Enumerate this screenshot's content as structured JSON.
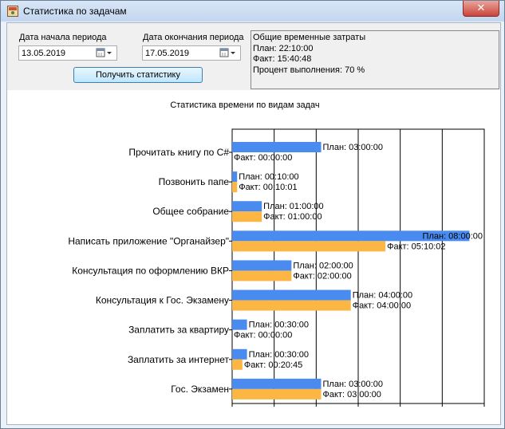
{
  "window": {
    "title": "Статистика по задачам",
    "close_label": "✕"
  },
  "filters": {
    "start_label": "Дата начала периода",
    "start_value": "13.05.2019",
    "end_label": "Дата окончания периода",
    "end_value": "17.05.2019",
    "button_label": "Получить статистику"
  },
  "summary": {
    "heading": "Общие временные затраты",
    "plan": "План: 22:10:00",
    "fact": "Факт: 15:40:48",
    "percent": "Процент выполнения: 70 %"
  },
  "colors": {
    "plan": "#4a8bef",
    "fact": "#fbb644"
  },
  "chart_data": {
    "type": "bar",
    "title": "Статистика времени по видам задач",
    "orientation": "horizontal",
    "x_unit": "hours",
    "xlim": [
      0,
      8.5
    ],
    "categories": [
      "Прочитать книгу по C#",
      "Позвонить папе",
      "Общее собрание",
      "Написать  приложение \"Органайзер\"",
      "Консультация по оформлению ВКР",
      "Консультация к Гос. Экзамену",
      "Заплатить за квартиру",
      "Заплатить за интернет",
      "Гос. Экзамен"
    ],
    "series": [
      {
        "values": [
          3.0,
          0.1667,
          1.0,
          8.0,
          2.0,
          4.0,
          0.5,
          0.5,
          3.0
        ],
        "labels": [
          "План: 03:00:00",
          "План: 00:10:00",
          "План: 01:00:00",
          "План: 08:00:00",
          "План: 02:00:00",
          "План: 04:00:00",
          "План: 00:30:00",
          "План: 00:30:00",
          "План: 03:00:00"
        ]
      },
      {
        "values": [
          0.0,
          0.1669,
          1.0,
          5.1672,
          2.0,
          4.0,
          0.0,
          0.3458,
          3.0
        ],
        "labels": [
          "Факт: 00:00:00",
          "Факт: 00:10:01",
          "Факт: 01:00:00",
          "Факт: 05:10:02",
          "Факт: 02:00:00",
          "Факт: 04:00:00",
          "Факт: 00:00:00",
          "Факт: 00:20:45",
          "Факт: 03:00:00"
        ]
      }
    ],
    "grid": true
  }
}
